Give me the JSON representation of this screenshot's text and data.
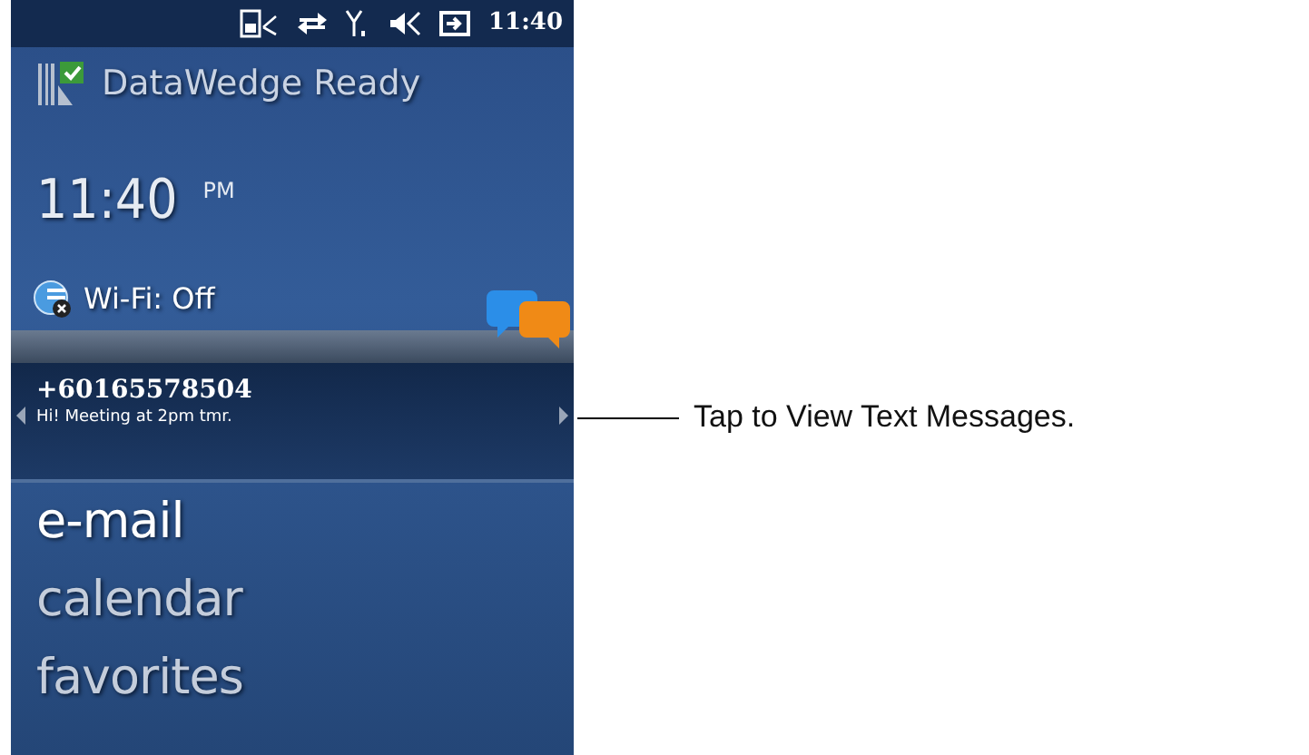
{
  "status_bar": {
    "time": "11:40"
  },
  "header": {
    "title": "DataWedge Ready"
  },
  "clock": {
    "time": "11:40",
    "period": "PM"
  },
  "wifi": {
    "label": "Wi-Fi: Off"
  },
  "message": {
    "sender": "+60165578504",
    "preview": "Hi! Meeting at 2pm tmr."
  },
  "menu": [
    {
      "label": "e-mail",
      "selected": true
    },
    {
      "label": "calendar",
      "selected": false
    },
    {
      "label": "favorites",
      "selected": false
    }
  ],
  "callout": {
    "text": "Tap to View Text Messages."
  }
}
